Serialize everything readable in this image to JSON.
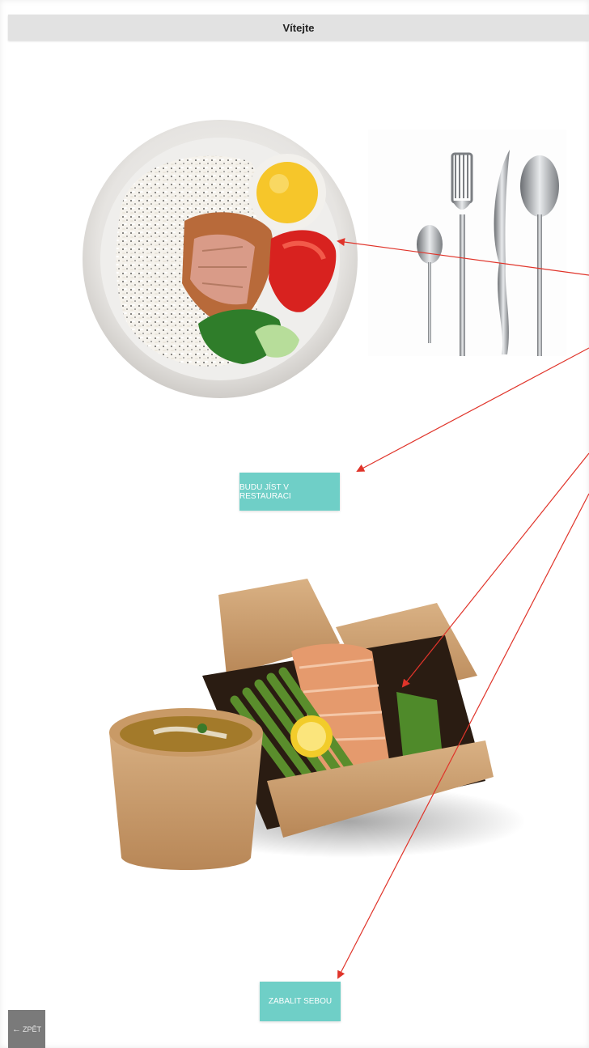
{
  "header": {
    "title": "Vítejte"
  },
  "options": {
    "dine_in_label": "BUDU JÍST V RESTAURACI",
    "takeaway_label": "ZABALIT SEBOU"
  },
  "footer": {
    "back_label": "ZPĚT",
    "back_icon": "arrow-left-icon"
  },
  "colors": {
    "button": "#6fcfc7",
    "header_bg": "#e2e2e2",
    "back_bg": "#7a7a7a",
    "annotation_arrow": "#e0342a"
  }
}
